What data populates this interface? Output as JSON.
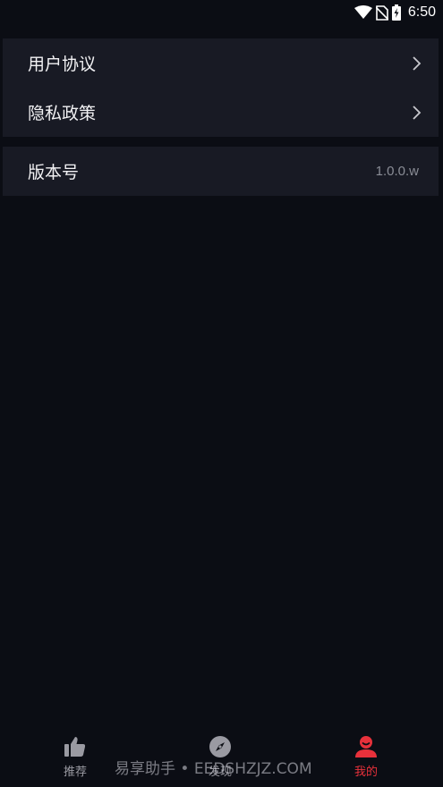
{
  "status_bar": {
    "time": "6:50",
    "icons": [
      "wifi-icon",
      "no-sim-icon",
      "battery-charging-icon"
    ]
  },
  "settings": {
    "user_agreement": "用户协议",
    "privacy_policy": "隐私政策",
    "version_label": "版本号",
    "version_value": "1.0.0.w"
  },
  "bottom_nav": {
    "items": [
      {
        "label": "推荐",
        "icon": "thumbs-up-icon",
        "active": false
      },
      {
        "label": "发现",
        "icon": "compass-icon",
        "active": false
      },
      {
        "label": "我的",
        "icon": "user-icon",
        "active": true
      }
    ]
  },
  "watermark": "易享助手 • EEDSHZJZ.COM",
  "colors": {
    "background": "#0b0d14",
    "card": "#181a24",
    "accent": "#e8313b",
    "inactive": "#9a9aa2"
  }
}
